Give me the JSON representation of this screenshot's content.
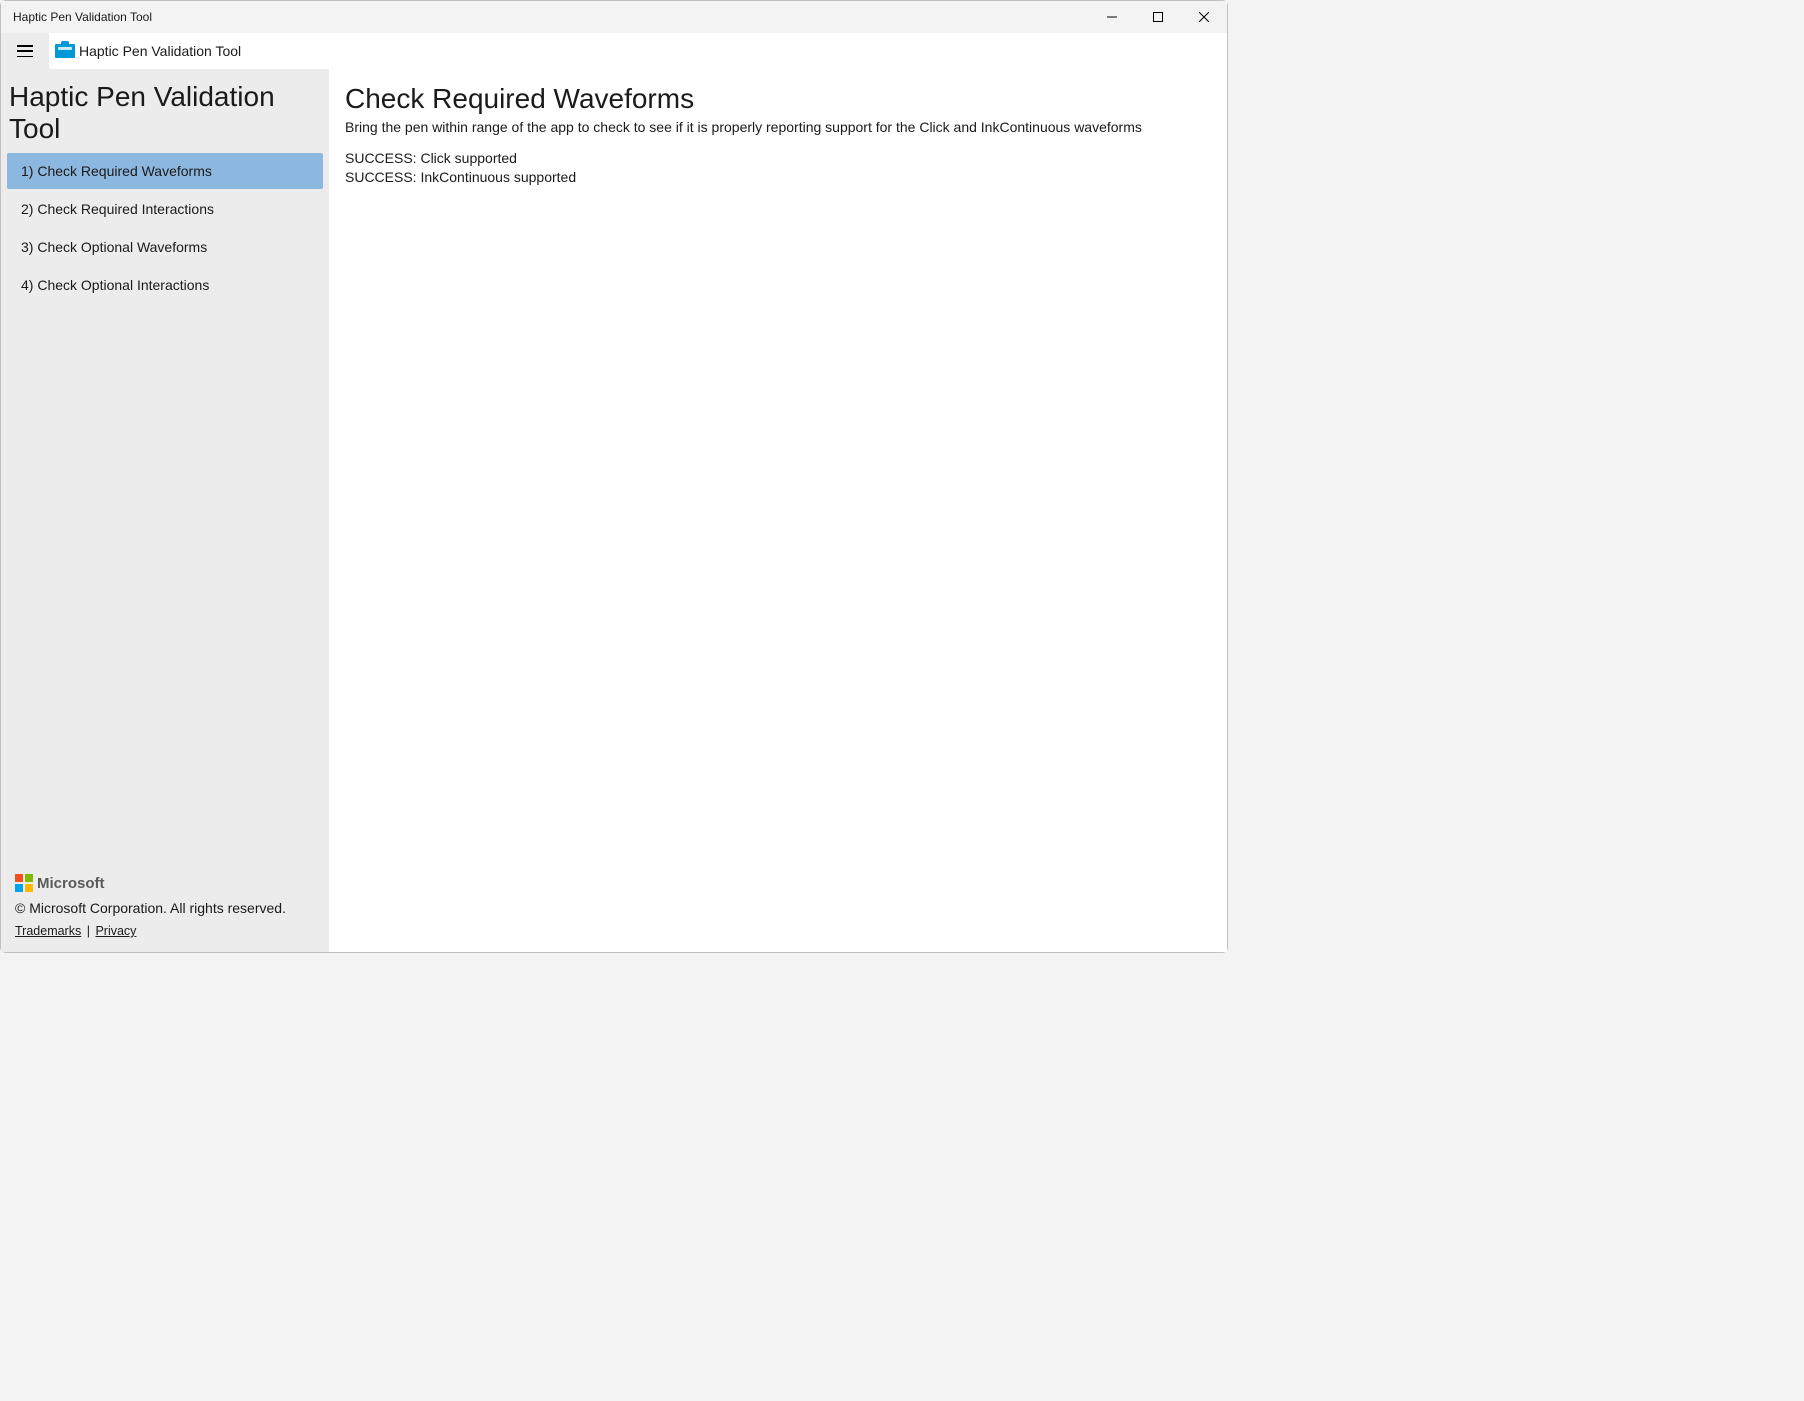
{
  "window": {
    "title": "Haptic Pen Validation Tool"
  },
  "header": {
    "app_title": "Haptic Pen Validation Tool"
  },
  "sidebar": {
    "heading": "Haptic Pen Validation Tool",
    "items": [
      {
        "label": "1) Check Required Waveforms",
        "selected": true
      },
      {
        "label": "2) Check Required Interactions",
        "selected": false
      },
      {
        "label": "3) Check Optional Waveforms",
        "selected": false
      },
      {
        "label": "4) Check Optional Interactions",
        "selected": false
      }
    ],
    "footer": {
      "brand": "Microsoft",
      "copyright": "© Microsoft Corporation. All rights reserved.",
      "trademarks": "Trademarks",
      "privacy": "Privacy",
      "sep": "|"
    }
  },
  "main": {
    "heading": "Check Required Waveforms",
    "description": "Bring the pen within range of the app to check to see if it is properly reporting support for the Click and InkContinuous waveforms",
    "results": [
      "SUCCESS: Click supported",
      "SUCCESS: InkContinuous supported"
    ]
  }
}
